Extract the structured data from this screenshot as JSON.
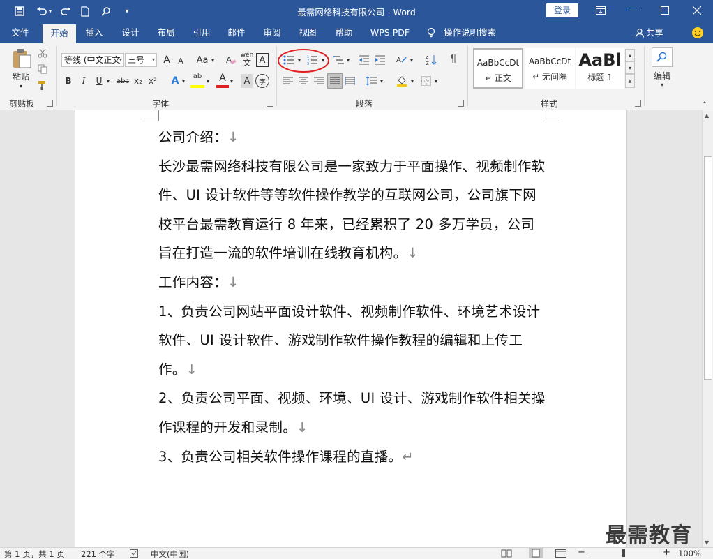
{
  "window": {
    "title": "最需网络科技有限公司  -  Word",
    "login_label": "登录"
  },
  "tabs": [
    "文件",
    "开始",
    "插入",
    "设计",
    "布局",
    "引用",
    "邮件",
    "审阅",
    "视图",
    "帮助",
    "WPS PDF"
  ],
  "tell_me": "操作说明搜索",
  "share_label": "共享",
  "ribbon": {
    "clipboard": {
      "paste_label": "粘贴",
      "group_label": "剪贴板"
    },
    "font": {
      "font_name": "等线 (中文正文",
      "font_size": "三号",
      "group_label": "字体",
      "grow_label": "A",
      "shrink_label": "A",
      "case_label": "Aa",
      "wen_label": "wén",
      "char_border_label": "A",
      "bold_label": "B",
      "italic_label": "I",
      "underline_label": "U",
      "strike_label": "abc",
      "sub_label": "x₂",
      "sup_label": "x²",
      "effects_label": "A",
      "highlight_label": "ab",
      "fontcolor_label": "A",
      "shading_label": "A",
      "enclose_label": "字"
    },
    "paragraph": {
      "group_label": "段落"
    },
    "styles": {
      "group_label": "样式",
      "items": [
        {
          "preview": "AaBbCcDt",
          "name": "↵ 正文"
        },
        {
          "preview": "AaBbCcDt",
          "name": "↵ 无间隔"
        },
        {
          "preview": "AaBl",
          "name": "标题 1"
        }
      ]
    },
    "editing": {
      "label": "编辑"
    }
  },
  "document": {
    "paragraphs": [
      {
        "text": "公司介绍：",
        "mark": "↓"
      },
      {
        "text": "长沙最需网络科技有限公司是一家致力于平面操作、视频制作软件、UI 设计软件等等软件操作教学的互联网公司，公司旗下网校平台最需教育运行 8 年来，已经累积了 20 多万学员，公司旨在打造一流的软件培训在线教育机构。",
        "mark": "↓"
      },
      {
        "text": "工作内容：",
        "mark": "↓"
      },
      {
        "text": "1、负责公司网站平面设计软件、视频制作软件、环境艺术设计软件、UI 设计软件、游戏制作软件操作教程的编辑和上传工作。",
        "mark": "↓"
      },
      {
        "text": "2、负责公司平面、视频、环境、UI 设计、游戏制作软件相关操作课程的开发和录制。",
        "mark": "↓"
      },
      {
        "text": "3、负责公司相关软件操作课程的直播。",
        "mark": "↵"
      }
    ]
  },
  "status": {
    "page": "第 1 页，共 1 页",
    "words": "221 个字",
    "language": "中文(中国)",
    "zoom": "100%"
  },
  "watermark": "最需教育",
  "colors": {
    "brand": "#2b579a",
    "highlight_circle": "#e02020"
  }
}
